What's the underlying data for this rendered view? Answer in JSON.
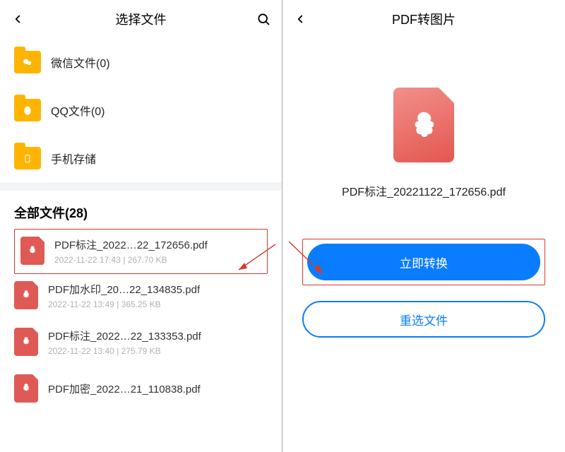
{
  "left": {
    "title": "选择文件",
    "sources": [
      {
        "label": "微信文件(0)",
        "icon": "wechat"
      },
      {
        "label": "QQ文件(0)",
        "icon": "qq"
      },
      {
        "label": "手机存储",
        "icon": "phone"
      }
    ],
    "section_title": "全部文件(28)",
    "files": [
      {
        "name": "PDF标注_2022…22_172656.pdf",
        "date": "2022-11-22 17:43",
        "size": "267.70 KB",
        "highlight": true
      },
      {
        "name": "PDF加水印_20…22_134835.pdf",
        "date": "2022-11-22 13:49",
        "size": "365.25 KB",
        "highlight": false
      },
      {
        "name": "PDF标注_2022…22_133353.pdf",
        "date": "2022-11-22 13:40",
        "size": "275.79 KB",
        "highlight": false
      },
      {
        "name": "PDF加密_2022…21_110838.pdf",
        "date": "",
        "size": "",
        "highlight": false
      }
    ]
  },
  "right": {
    "title": "PDF转图片",
    "filename": "PDF标注_20221122_172656.pdf",
    "btn_primary": "立即转换",
    "btn_outline": "重选文件"
  }
}
